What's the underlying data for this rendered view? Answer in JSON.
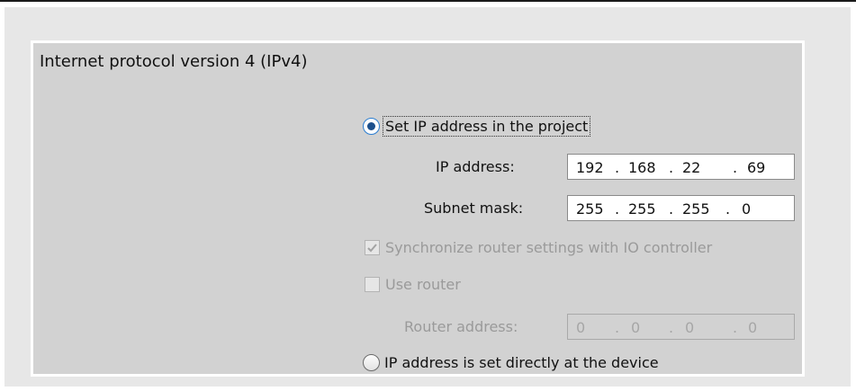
{
  "section": {
    "title": "Internet protocol version 4 (IPv4)"
  },
  "options": {
    "set_in_project": {
      "label": "Set IP address in the project",
      "selected": true
    },
    "set_at_device": {
      "label": "IP address is set directly at the device",
      "selected": false
    }
  },
  "fields": {
    "ip_address": {
      "label": "IP address:",
      "octets": [
        "192",
        "168",
        "22",
        "69"
      ],
      "separator": "."
    },
    "subnet_mask": {
      "label": "Subnet mask:",
      "octets": [
        "255",
        "255",
        "255",
        "0"
      ],
      "separator": "."
    },
    "router_address": {
      "label": "Router address:",
      "octets": [
        "0",
        "0",
        "0",
        "0"
      ],
      "separator": ".",
      "disabled": true
    }
  },
  "checkboxes": {
    "sync_router": {
      "label": "Synchronize router settings with IO controller",
      "checked": true,
      "disabled": true
    },
    "use_router": {
      "label": "Use router",
      "checked": false,
      "disabled": true
    }
  },
  "colors": {
    "panel_bg": "#d2d2d2",
    "outer_bg": "#e7e7e7",
    "radio_accent": "#2f7fd0",
    "disabled_text": "#9a9a9a"
  },
  "icons": {
    "checked": "checkmark-icon",
    "radio_selected": "radio-selected-icon",
    "radio_unselected": "radio-unselected-icon"
  }
}
